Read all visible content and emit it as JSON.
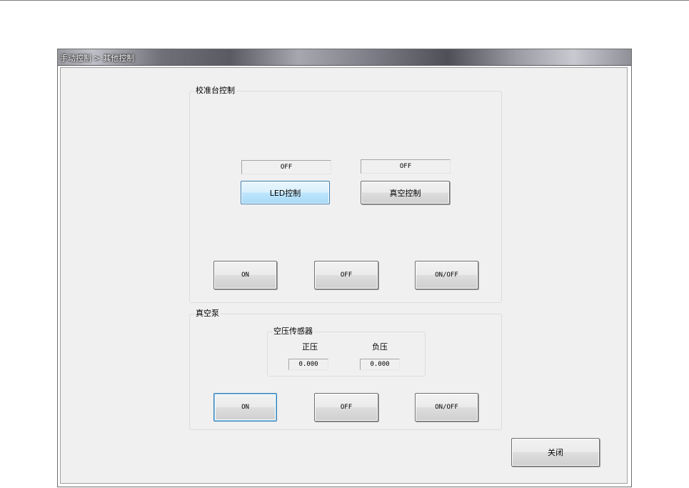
{
  "window": {
    "title": "手动控制 > 其他控制"
  },
  "calib_group": {
    "label": "校准台控制",
    "led_status": "OFF",
    "vacuum_status": "OFF",
    "led_button": "LED控制",
    "vacuum_button": "真空控制",
    "on_button": "ON",
    "off_button": "OFF",
    "onoff_button": "ON/OFF"
  },
  "pump_group": {
    "label": "真空泵",
    "sensor": {
      "label": "空压传感器",
      "positive_label": "正压",
      "negative_label": "负压",
      "positive_value": "0.000",
      "negative_value": "0.000"
    },
    "on_button": "ON",
    "off_button": "OFF",
    "onoff_button": "ON/OFF"
  },
  "close_button": "关闭"
}
